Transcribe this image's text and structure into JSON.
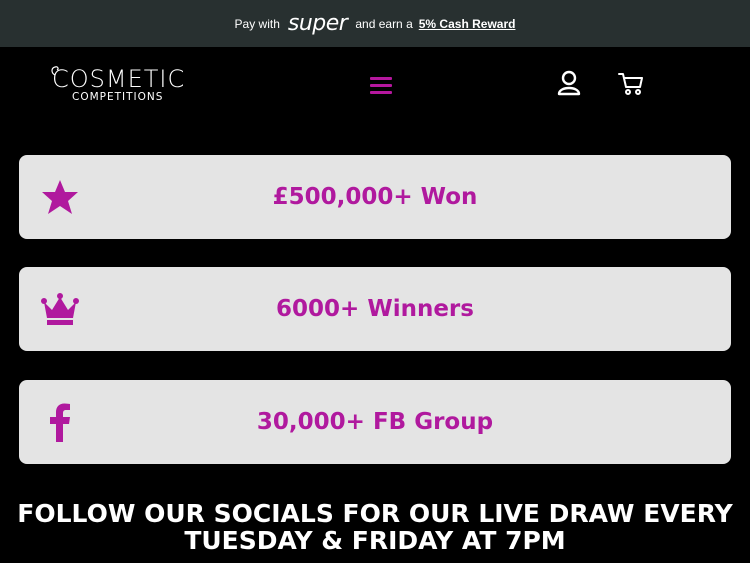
{
  "promo": {
    "prefix": "Pay with",
    "brand": "super",
    "middle": "and earn a",
    "reward": "5% Cash Reward"
  },
  "logo": {
    "line1": "COSMETIC",
    "line2": "COMPETITIONS"
  },
  "header": {
    "menu_icon": "hamburger-icon",
    "account_icon": "user-icon",
    "cart_icon": "cart-icon"
  },
  "stats": [
    {
      "icon": "star-icon",
      "label": "£500,000+ Won"
    },
    {
      "icon": "crown-icon",
      "label": "6000+ Winners"
    },
    {
      "icon": "facebook-icon",
      "label": "30,000+ FB Group"
    }
  ],
  "follow": {
    "line1": "FOLLOW OUR SOCIALS FOR OUR LIVE DRAW EVERY",
    "line2": "TUESDAY & FRIDAY AT 7PM"
  },
  "colors": {
    "accent": "#b0199e",
    "promo_bg": "#283030",
    "card_bg": "#e4e4e4",
    "page_bg": "#000000"
  }
}
